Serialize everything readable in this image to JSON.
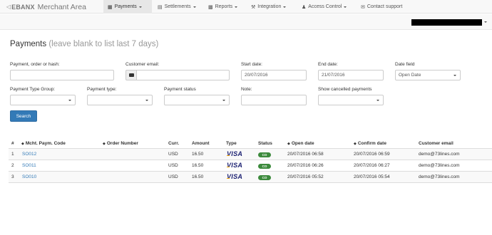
{
  "app": {
    "logo_text": "EBANX",
    "title": "Merchant Area"
  },
  "nav": [
    {
      "label": "Payments",
      "icon": "book-icon",
      "active": true
    },
    {
      "label": "Settlements",
      "icon": "chart-icon"
    },
    {
      "label": "Reports",
      "icon": "folder-icon"
    },
    {
      "label": "Integration",
      "icon": "wrench-icon"
    },
    {
      "label": "Access Control",
      "icon": "user-icon"
    },
    {
      "label": "Contact support",
      "icon": "envelope-icon"
    }
  ],
  "page": {
    "title": "Payments",
    "hint": "(leave blank to list last 7 days)"
  },
  "form": {
    "payment_order_hash": {
      "label": "Payment, order or hash:",
      "value": ""
    },
    "customer_email": {
      "label": "Customer email:",
      "value": ""
    },
    "start_date": {
      "label": "Start date:",
      "value": "20/07/2016"
    },
    "end_date": {
      "label": "End date:",
      "value": "21/07/2016"
    },
    "date_field": {
      "label": "Date field",
      "value": "Open Date"
    },
    "payment_type_group": {
      "label": "Payment Type Group:",
      "value": ""
    },
    "payment_type": {
      "label": "Payment type:",
      "value": ""
    },
    "payment_status": {
      "label": "Payment status",
      "value": ""
    },
    "note": {
      "label": "Note:",
      "value": ""
    },
    "show_cancelled": {
      "label": "Show cancelled payments",
      "value": ""
    },
    "search_button": "Search"
  },
  "table": {
    "headers": {
      "num": "#",
      "mcht": "Mcht. Paym. Code",
      "order": "Order Number",
      "curr": "Curr.",
      "amount": "Amount",
      "type": "Type",
      "status": "Status",
      "open": "Open date",
      "confirm": "Confirm date",
      "email": "Customer email"
    },
    "rows": [
      {
        "num": "1",
        "code": "SO012",
        "order": "",
        "curr": "USD",
        "amount": "16.50",
        "type": "VISA",
        "status": "CO",
        "open": "20/07/2016 06:58",
        "confirm": "20/07/2016 06:59",
        "email": "demo@73lines.com"
      },
      {
        "num": "2",
        "code": "SO011",
        "order": "",
        "curr": "USD",
        "amount": "16.50",
        "type": "VISA",
        "status": "CO",
        "open": "20/07/2016 06:26",
        "confirm": "20/07/2016 06:27",
        "email": "demo@73lines.com"
      },
      {
        "num": "3",
        "code": "SO010",
        "order": "",
        "curr": "USD",
        "amount": "16.50",
        "type": "VISA",
        "status": "CO",
        "open": "20/07/2016 05:52",
        "confirm": "20/07/2016 05:54",
        "email": "demo@73lines.com"
      }
    ]
  },
  "colors": {
    "primary": "#337ab7",
    "status_green": "#3c8a3c",
    "visa_blue": "#1a1f71"
  }
}
